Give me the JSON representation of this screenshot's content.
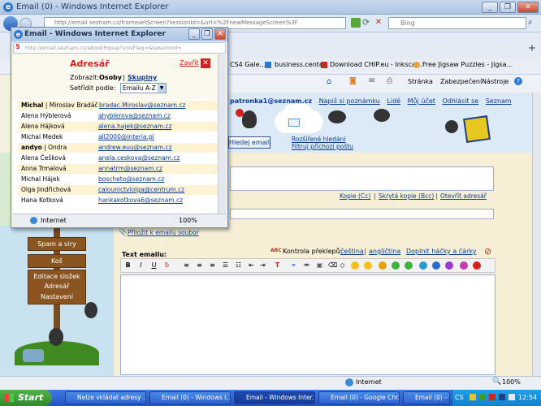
{
  "main_window": {
    "title": "Email (0) - Windows Internet Explorer",
    "url": "http://email.seznam.cz/framesetScreen?sessionId=&url=%2FnewMessageScreen%3F",
    "search_placeholder": "Bing",
    "favorites": [
      "CS4 Gale...",
      "business.center",
      "Download CHIP.eu - Inksca...",
      "Free Jigsaw Puzzles - Jigsa..."
    ],
    "commands": [
      "Stránka",
      "Zabezpečení",
      "Nástroje"
    ],
    "status_zone": "Internet",
    "zoom": "100%"
  },
  "site": {
    "user_email": "patronka1@seznam.cz",
    "top_links": [
      "Napiš si poznámku",
      "Lidé",
      "Můj účet",
      "Odhlásit se",
      "Seznam"
    ],
    "search_button": "Hledej email",
    "advanced_search": "Rozšířené hledání",
    "filter_mail": "Filtruj příchozí poštu",
    "cc_link": "Kopie (Cc)",
    "bcc_link": "Skrytá kopie (Bcc)",
    "open_addressbook": "Otevřít adresář",
    "attach_link": "Přiložit k emailu soubor",
    "text_label": "Text emailu:",
    "spellcheck_label": "Kontrola překlepů:",
    "lang_cz": "čeština",
    "lang_en": "angličtina",
    "diacritics": "Doplnit háčky a čárky",
    "sidebar": [
      "Spam a viry",
      "Koš",
      "Editace složek",
      "Adresář",
      "Nastavení"
    ]
  },
  "popup": {
    "title": "Email - Windows Internet Explorer",
    "url": "http://email.seznam.cz/abookPopup?smsFlag=&sessionId=",
    "heading": "Adresář",
    "close_label": "Zavřít",
    "show_label": "Zobrazit:",
    "show_value": "Osoby",
    "groups_link": "Skupiny",
    "sort_label": "Setřídit podle:",
    "sort_value": "Emailu A-Z",
    "contacts": [
      {
        "name": "Michal",
        "extra": "| Miroslav Bradáč",
        "email": "bradac.Miroslav@seznam.cz"
      },
      {
        "name": "Alena Hýblerová",
        "extra": "",
        "email": "ahyblerova@seznam.cz"
      },
      {
        "name": "Alena Hájková",
        "extra": "",
        "email": "alena.hajek@seznam.cz"
      },
      {
        "name": "Michal Medek",
        "extra": "",
        "email": "all2000@interia.pl"
      },
      {
        "name": "andyo",
        "extra": "| Ondra",
        "email": "andrew.euu@seznam.cz"
      },
      {
        "name": "Alena Češková",
        "extra": "",
        "email": "anela.ceskova@seznam.cz"
      },
      {
        "name": "Anna Trmalová",
        "extra": "",
        "email": "annatrm@seznam.cz"
      },
      {
        "name": "Michal Hájek",
        "extra": "",
        "email": "boscheto@seznam.cz"
      },
      {
        "name": "Olga Jindřichová",
        "extra": "",
        "email": "calounictviolga@centrum.cz"
      },
      {
        "name": "Hana Kotková",
        "extra": "",
        "email": "hankakotkova6@seznam.cz"
      }
    ],
    "status_zone": "Internet",
    "zoom": "100%"
  },
  "taskbar": {
    "start": "Start",
    "tasks": [
      "Nelze vkládat adresy ...",
      "Email (0) - Windows I...",
      "Email - Windows Inter...",
      "Email (0) - Google Chr...",
      "Email (0) - Windows I..."
    ],
    "lang": "CS",
    "clock": "12:54"
  }
}
